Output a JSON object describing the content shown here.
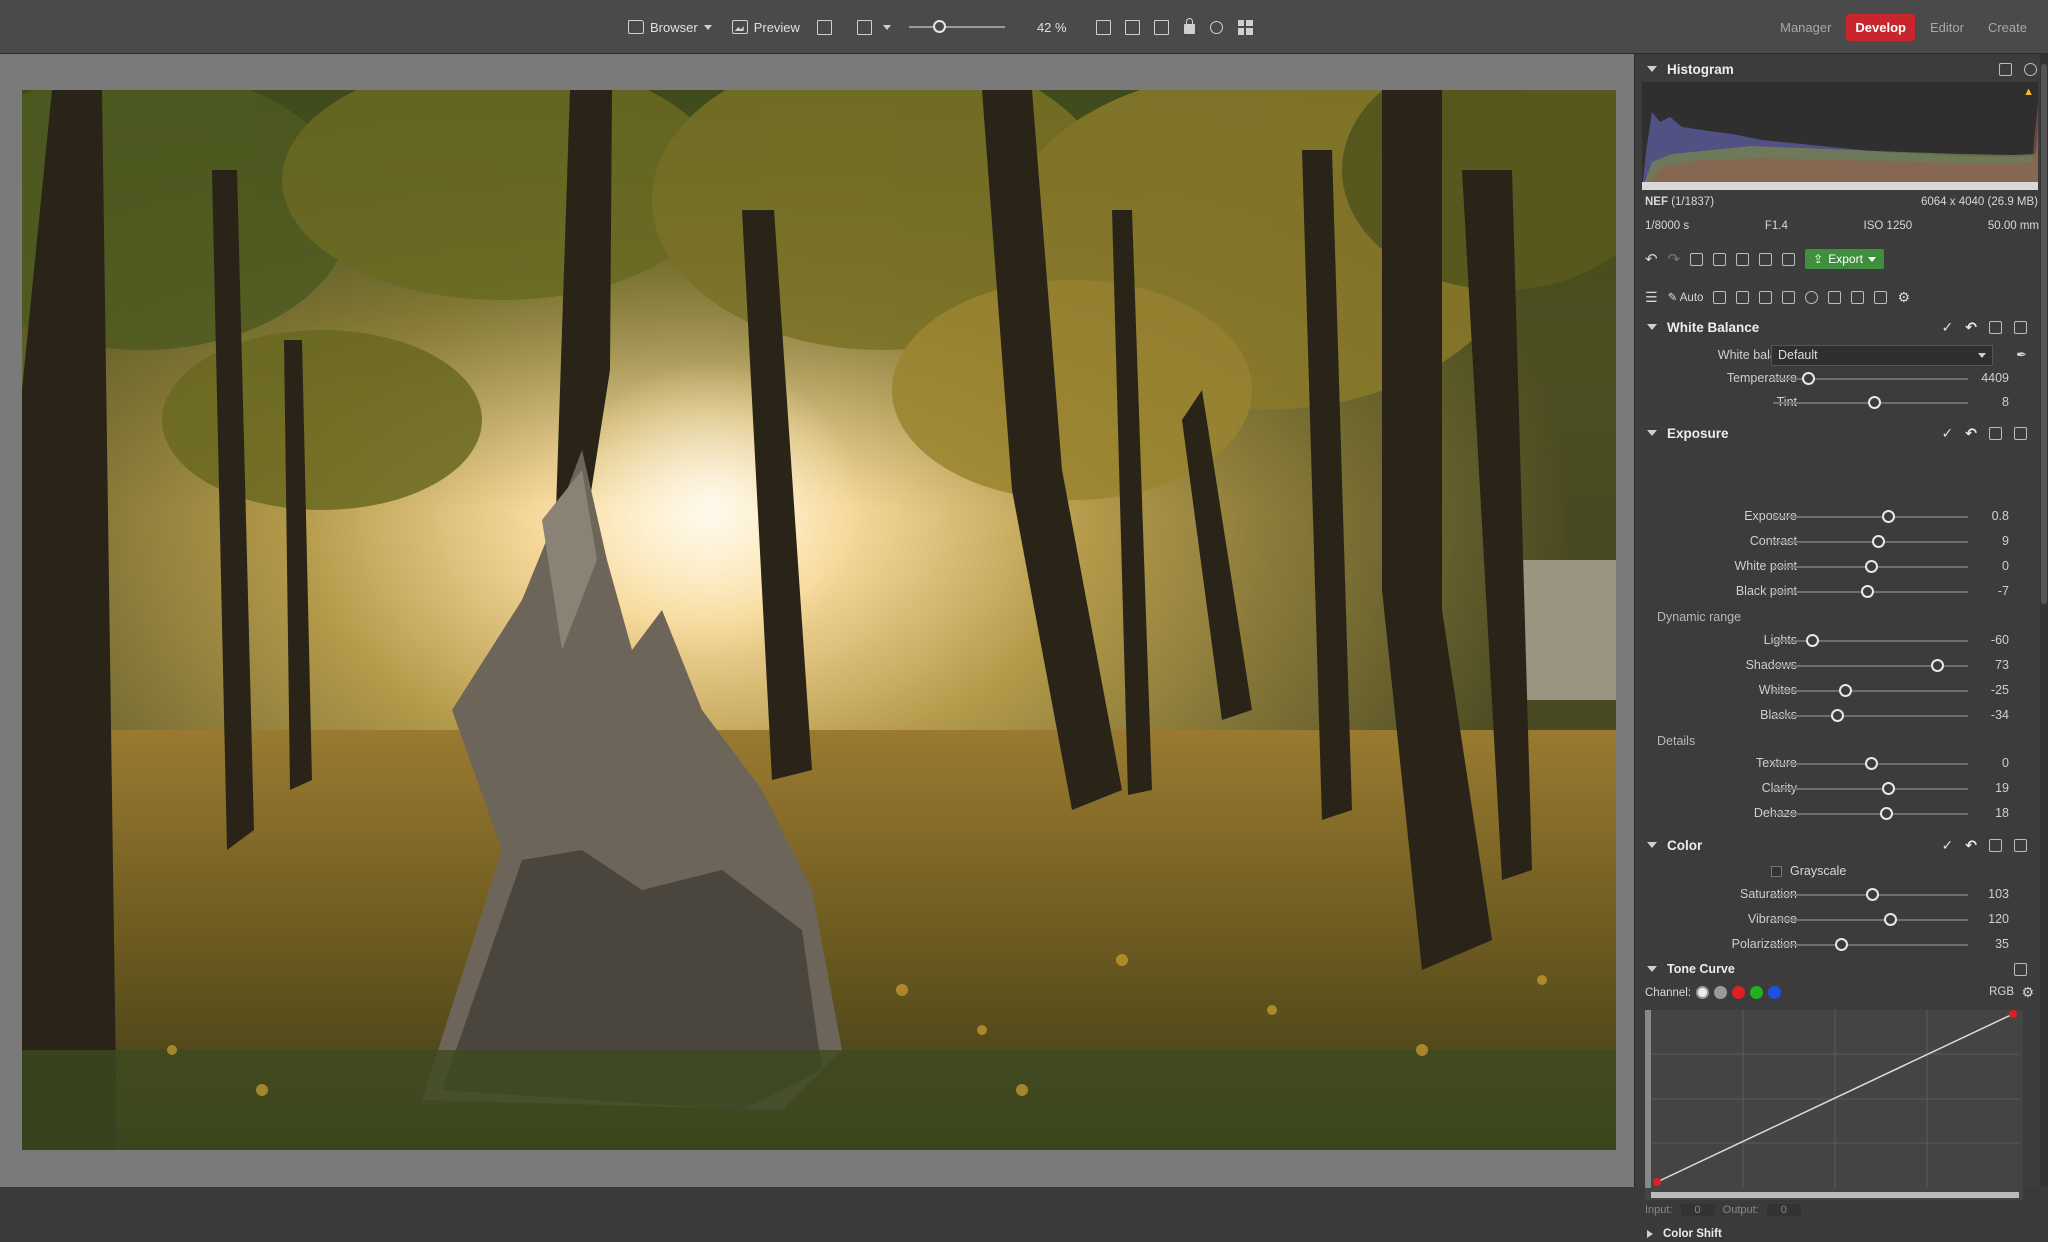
{
  "toolbar": {
    "browser_label": "Browser",
    "preview_label": "Preview",
    "zoom_value": "42 %"
  },
  "modes": [
    {
      "label": "Manager",
      "active": false
    },
    {
      "label": "Develop",
      "active": true
    },
    {
      "label": "Editor",
      "active": false
    },
    {
      "label": "Create",
      "active": false
    }
  ],
  "histogram": {
    "title": "Histogram",
    "file_type": "NEF",
    "file_index": "(1/1837)",
    "dimensions": "6064 x 4040 (26.9 MB)",
    "shutter": "1/8000 s",
    "aperture": "F1.4",
    "iso": "ISO 1250",
    "focal": "50.00 mm"
  },
  "actions": {
    "export_label": "Export",
    "auto_label": "Auto"
  },
  "white_balance": {
    "title": "White Balance",
    "preset_label": "White balance",
    "preset_value": "Default",
    "sliders": [
      {
        "label": "Temperature",
        "value": "4409",
        "pos": 0.18
      },
      {
        "label": "Tint",
        "value": "8",
        "pos": 0.52
      }
    ]
  },
  "exposure": {
    "title": "Exposure",
    "sliders": [
      {
        "label": "Exposure",
        "value": "0.8",
        "pos": 0.59
      },
      {
        "label": "Contrast",
        "value": "9",
        "pos": 0.54
      },
      {
        "label": "White point",
        "value": "0",
        "pos": 0.5
      },
      {
        "label": "Black point",
        "value": "-7",
        "pos": 0.48
      }
    ],
    "dynamic_range_label": "Dynamic range",
    "dynamic_range": [
      {
        "label": "Lights",
        "value": "-60",
        "pos": 0.2
      },
      {
        "label": "Shadows",
        "value": "73",
        "pos": 0.84
      },
      {
        "label": "Whites",
        "value": "-25",
        "pos": 0.37
      },
      {
        "label": "Blacks",
        "value": "-34",
        "pos": 0.33
      }
    ],
    "details_label": "Details",
    "details": [
      {
        "label": "Texture",
        "value": "0",
        "pos": 0.5
      },
      {
        "label": "Clarity",
        "value": "19",
        "pos": 0.59
      },
      {
        "label": "Dehaze",
        "value": "18",
        "pos": 0.58
      }
    ]
  },
  "color": {
    "title": "Color",
    "grayscale_label": "Grayscale",
    "sliders": [
      {
        "label": "Saturation",
        "value": "103",
        "pos": 0.51
      },
      {
        "label": "Vibrance",
        "value": "120",
        "pos": 0.6
      },
      {
        "label": "Polarization",
        "value": "35",
        "pos": 0.35
      }
    ]
  },
  "tone_curve": {
    "title": "Tone Curve",
    "channel_label": "Channel:",
    "channel_value": "RGB",
    "input_label": "Input:",
    "input_value": "0",
    "output_label": "Output:",
    "output_value": "0"
  },
  "color_shift": {
    "title": "Color Shift"
  },
  "colors": {
    "accent": "#c8262c",
    "export_green": "#3f8f3f"
  }
}
